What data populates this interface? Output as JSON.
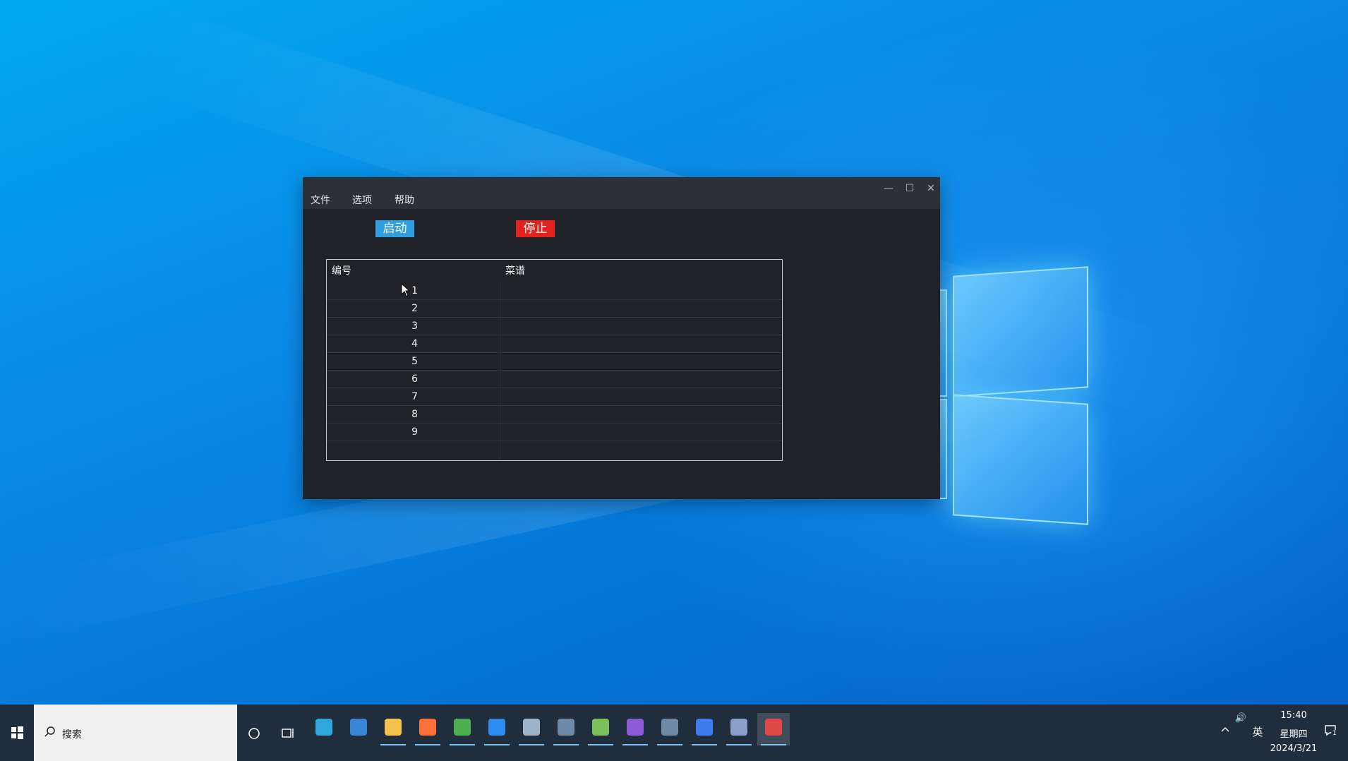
{
  "window": {
    "menu": [
      "文件",
      "选项",
      "帮助"
    ],
    "controls": {
      "minimize": "—",
      "maximize": "☐",
      "close": "✕"
    }
  },
  "buttons": {
    "start_label": "启动",
    "stop_label": "停止"
  },
  "table": {
    "columns": [
      "编号",
      "菜谱"
    ],
    "rows": [
      {
        "no": "1",
        "menu": ""
      },
      {
        "no": "2",
        "menu": ""
      },
      {
        "no": "3",
        "menu": ""
      },
      {
        "no": "4",
        "menu": ""
      },
      {
        "no": "5",
        "menu": ""
      },
      {
        "no": "6",
        "menu": ""
      },
      {
        "no": "7",
        "menu": ""
      },
      {
        "no": "8",
        "menu": ""
      },
      {
        "no": "9",
        "menu": ""
      },
      {
        "no": "",
        "menu": ""
      }
    ]
  },
  "taskbar": {
    "search_placeholder": "搜索",
    "pinned_apps": [
      {
        "name": "edge-icon",
        "color": "#2fa6de"
      },
      {
        "name": "store-icon",
        "color": "#3a86d6"
      },
      {
        "name": "file-explorer-icon",
        "color": "#f2c14e"
      },
      {
        "name": "firefox-icon",
        "color": "#ff7139"
      },
      {
        "name": "chrome-icon",
        "color": "#4caf50"
      },
      {
        "name": "search-app-icon",
        "color": "#2d8cf0"
      },
      {
        "name": "image-viewer-icon",
        "color": "#9fb3c8"
      },
      {
        "name": "car-app-icon",
        "color": "#6f8aa8"
      },
      {
        "name": "notepad-icon",
        "color": "#7bbf5a"
      },
      {
        "name": "visual-studio-icon",
        "color": "#8e5bd8"
      },
      {
        "name": "car-app-2-icon",
        "color": "#6f8aa8"
      },
      {
        "name": "pen-app-icon",
        "color": "#3f7cf0"
      },
      {
        "name": "tools-icon",
        "color": "#8aa0c8"
      },
      {
        "name": "paint-app-icon",
        "color": "#e04848"
      }
    ],
    "tray": {
      "volume": "🔊",
      "ime": "英",
      "time": "15:40",
      "weekday": "星期四",
      "date": "2024/3/21",
      "notification_count": "1"
    }
  }
}
